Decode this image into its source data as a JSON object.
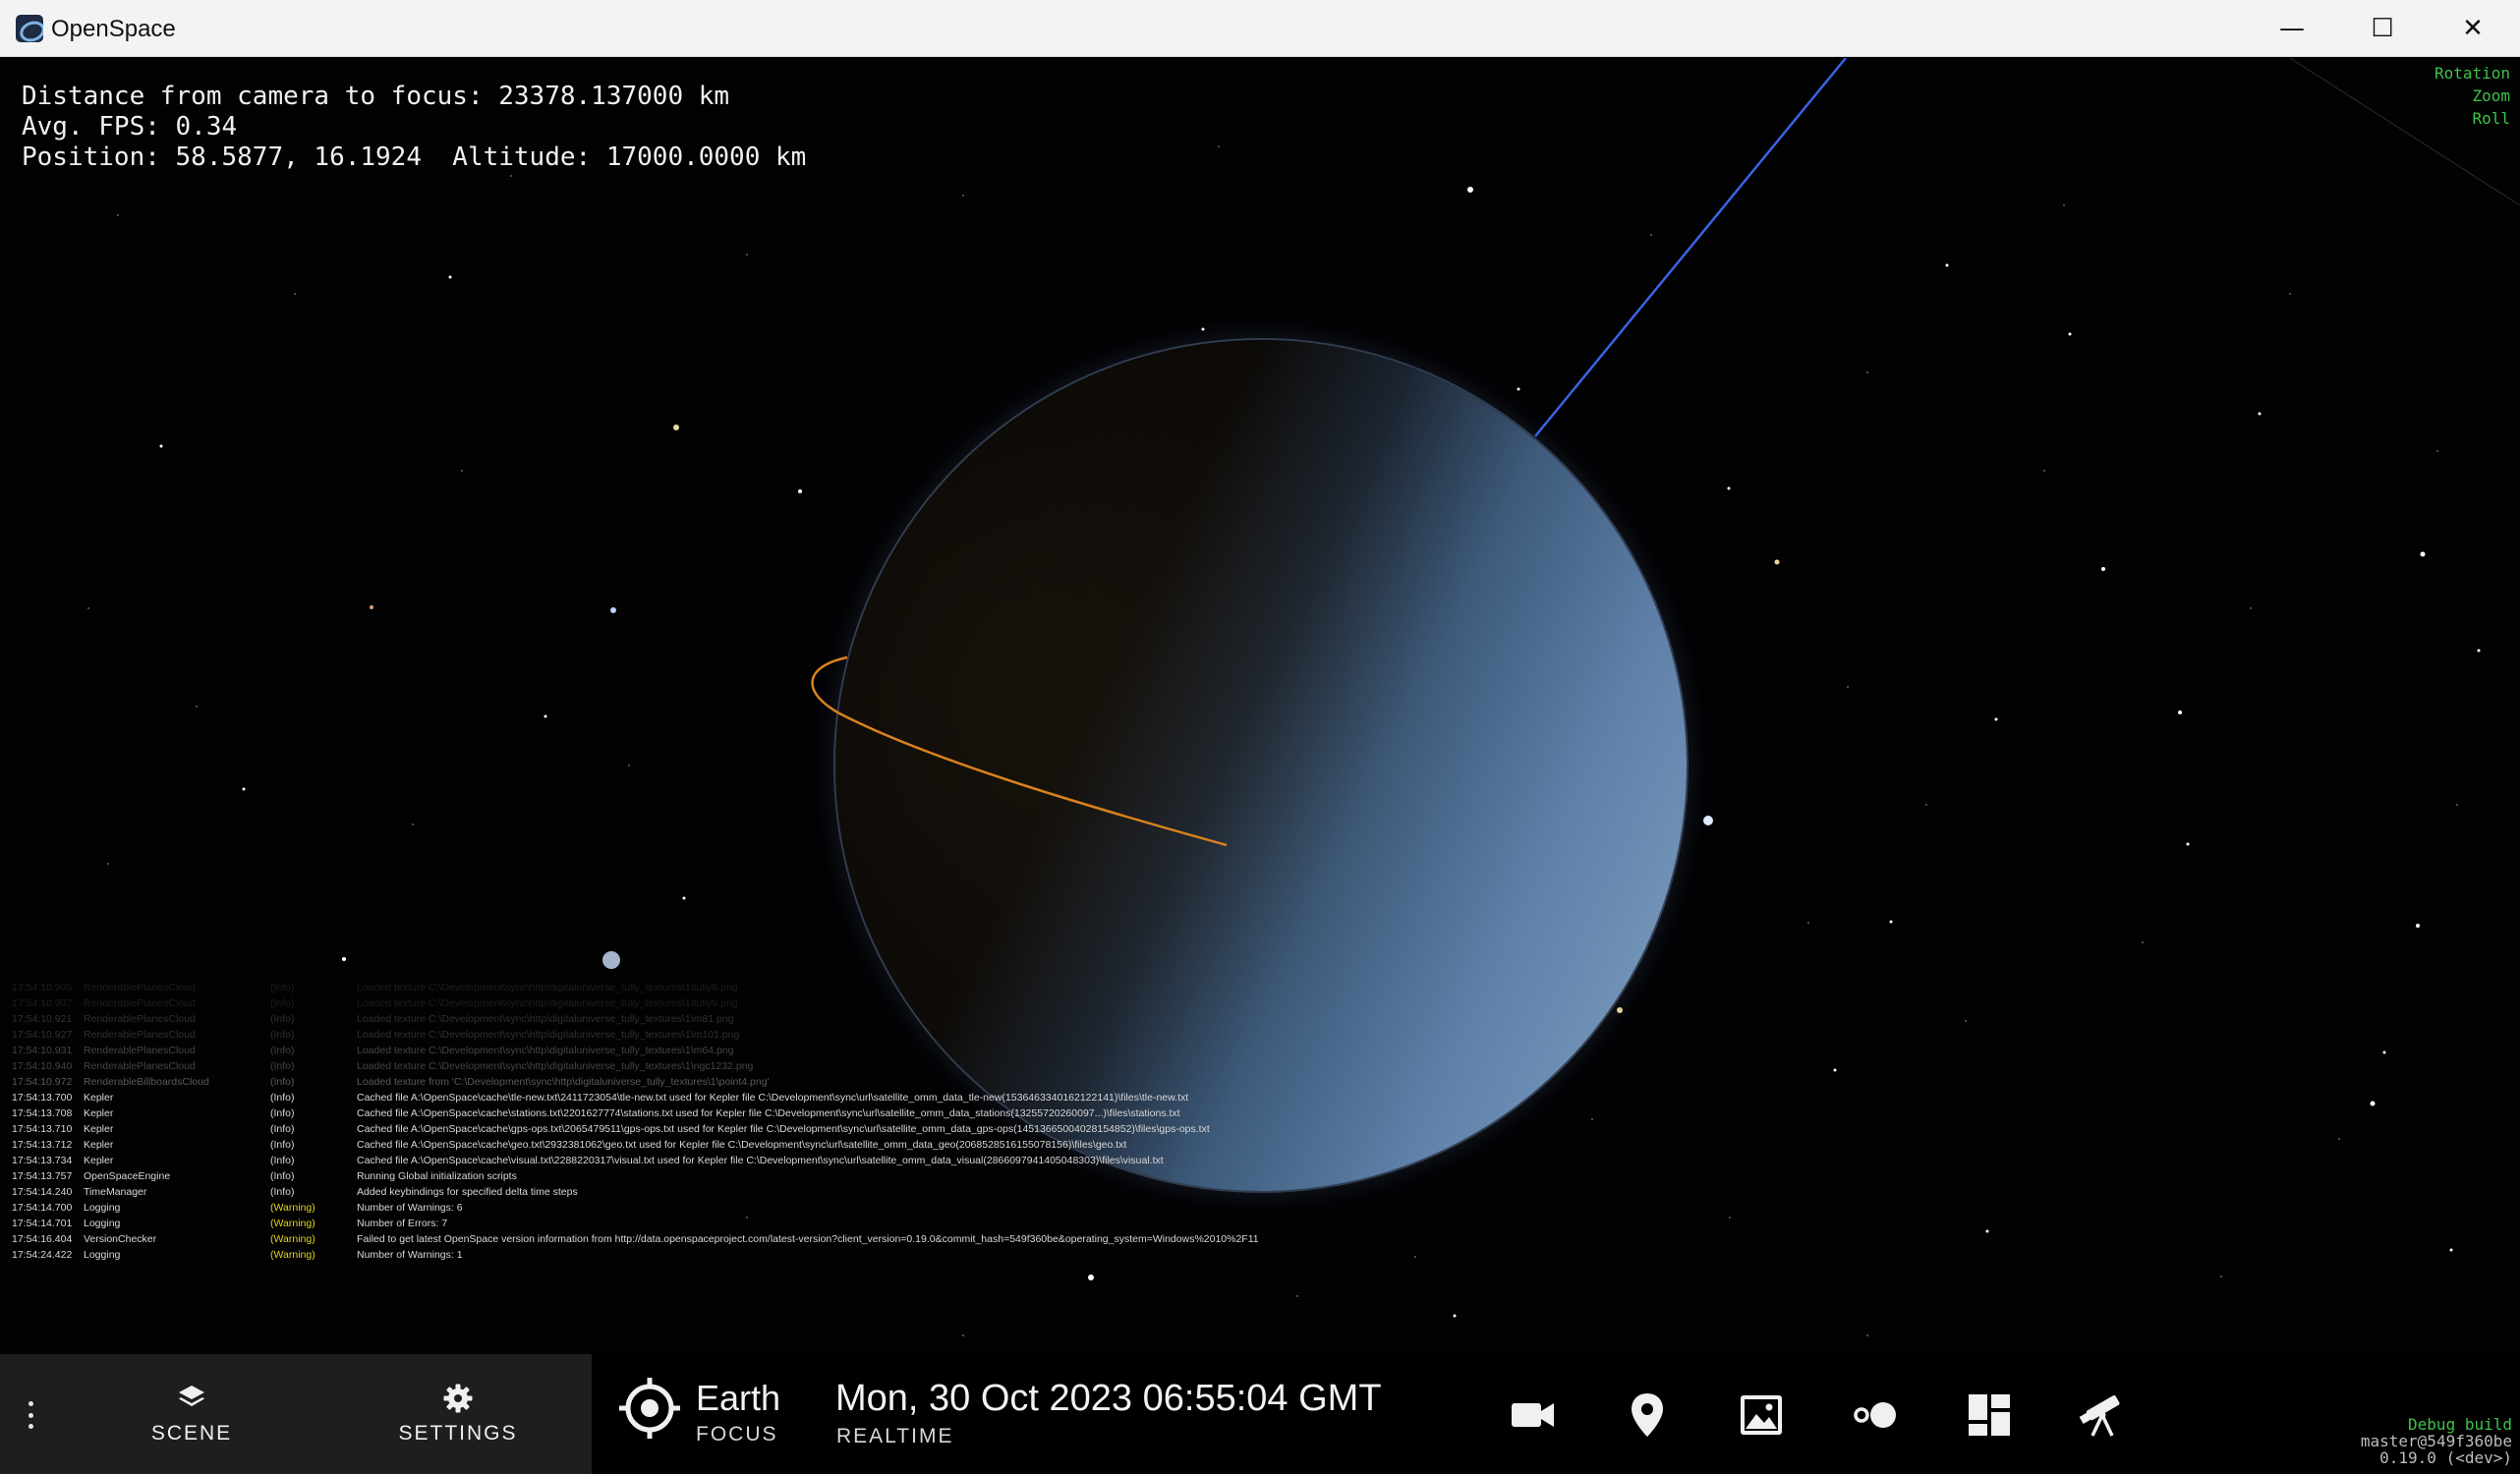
{
  "window": {
    "title": "OpenSpace",
    "minimize_glyph": "—",
    "maximize_glyph": "☐",
    "close_glyph": "✕"
  },
  "hud": {
    "distance": "Distance from camera to focus: 23378.137000 km",
    "fps": "Avg. FPS: 0.34",
    "position": "Position: 58.5877, 16.1924  Altitude: 17000.0000 km"
  },
  "nav_hints": [
    "Rotation",
    "Zoom",
    "Roll"
  ],
  "log": [
    {
      "time": "17:54:10.905",
      "category": "RenderablePlanesCloud",
      "level": "(Info)",
      "message": "Loaded texture C:\\Development\\sync\\http\\digitaluniverse_tully_textures\\1\\tully8.png"
    },
    {
      "time": "17:54:10.907",
      "category": "RenderablePlanesCloud",
      "level": "(Info)",
      "message": "Loaded texture C:\\Development\\sync\\http\\digitaluniverse_tully_textures\\1\\tully9.png"
    },
    {
      "time": "17:54:10.921",
      "category": "RenderablePlanesCloud",
      "level": "(Info)",
      "message": "Loaded texture C:\\Development\\sync\\http\\digitaluniverse_tully_textures\\1\\m81.png"
    },
    {
      "time": "17:54:10.927",
      "category": "RenderablePlanesCloud",
      "level": "(Info)",
      "message": "Loaded texture C:\\Development\\sync\\http\\digitaluniverse_tully_textures\\1\\m101.png"
    },
    {
      "time": "17:54:10.931",
      "category": "RenderablePlanesCloud",
      "level": "(Info)",
      "message": "Loaded texture C:\\Development\\sync\\http\\digitaluniverse_tully_textures\\1\\m64.png"
    },
    {
      "time": "17:54:10.940",
      "category": "RenderablePlanesCloud",
      "level": "(Info)",
      "message": "Loaded texture C:\\Development\\sync\\http\\digitaluniverse_tully_textures\\1\\ngc1232.png"
    },
    {
      "time": "17:54:10.972",
      "category": "RenderableBillboardsCloud",
      "level": "(Info)",
      "message": "Loaded texture from 'C:\\Development\\sync\\http\\digitaluniverse_tully_textures\\1\\point4.png'"
    },
    {
      "time": "17:54:13.700",
      "category": "Kepler",
      "level": "(Info)",
      "message": "Cached file A:\\OpenSpace\\cache\\tle-new.txt\\2411723054\\tle-new.txt used for Kepler file C:\\Development\\sync\\url\\satellite_omm_data_tle-new(1536463340162122141)\\files\\tle-new.txt"
    },
    {
      "time": "17:54:13.708",
      "category": "Kepler",
      "level": "(Info)",
      "message": "Cached file A:\\OpenSpace\\cache\\stations.txt\\2201627774\\stations.txt used for Kepler file C:\\Development\\sync\\url\\satellite_omm_data_stations(13255720260097...)\\files\\stations.txt"
    },
    {
      "time": "17:54:13.710",
      "category": "Kepler",
      "level": "(Info)",
      "message": "Cached file A:\\OpenSpace\\cache\\gps-ops.txt\\2065479511\\gps-ops.txt used for Kepler file C:\\Development\\sync\\url\\satellite_omm_data_gps-ops(14513665004028154852)\\files\\gps-ops.txt"
    },
    {
      "time": "17:54:13.712",
      "category": "Kepler",
      "level": "(Info)",
      "message": "Cached file A:\\OpenSpace\\cache\\geo.txt\\2932381062\\geo.txt used for Kepler file C:\\Development\\sync\\url\\satellite_omm_data_geo(2068528516155078156)\\files\\geo.txt"
    },
    {
      "time": "17:54:13.734",
      "category": "Kepler",
      "level": "(Info)",
      "message": "Cached file A:\\OpenSpace\\cache\\visual.txt\\2288220317\\visual.txt used for Kepler file C:\\Development\\sync\\url\\satellite_omm_data_visual(2866097941405048303)\\files\\visual.txt"
    },
    {
      "time": "17:54:13.757",
      "category": "OpenSpaceEngine",
      "level": "(Info)",
      "message": "Running Global initialization scripts"
    },
    {
      "time": "17:54:14.240",
      "category": "TimeManager",
      "level": "(Info)",
      "message": "Added keybindings for specified delta time steps"
    },
    {
      "time": "17:54:14.700",
      "category": "Logging",
      "level": "(Warning)",
      "message": "Number of Warnings: 6"
    },
    {
      "time": "17:54:14.701",
      "category": "Logging",
      "level": "(Warning)",
      "message": "Number of Errors: 7"
    },
    {
      "time": "17:54:16.404",
      "category": "VersionChecker",
      "level": "(Warning)",
      "message": "Failed to get latest OpenSpace version information from http://data.openspaceproject.com/latest-version?client_version=0.19.0&commit_hash=549f360be&operating_system=Windows%2010%2F11"
    },
    {
      "time": "17:54:24.422",
      "category": "Logging",
      "level": "(Warning)",
      "message": "Number of Warnings: 1"
    }
  ],
  "bottom": {
    "scene_label": "SCENE",
    "settings_label": "SETTINGS",
    "focus_name": "Earth",
    "focus_label": "FOCUS",
    "time": "Mon, 30 Oct 2023 06:55:04 GMT",
    "time_mode": "REALTIME",
    "tools": [
      "video-camera-icon",
      "map-pin-icon",
      "image-icon",
      "toggle-dots-icon",
      "dashboard-icon",
      "telescope-icon"
    ]
  },
  "build": {
    "debug": "Debug build",
    "commit": "master@549f360be",
    "version": "0.19.0 (<dev>)"
  },
  "colors": {
    "warning": "#e6d21f",
    "hint_green": "#3ec24a",
    "orbit_orange": "#d8821e",
    "trail_blue": "#3a63e6"
  }
}
